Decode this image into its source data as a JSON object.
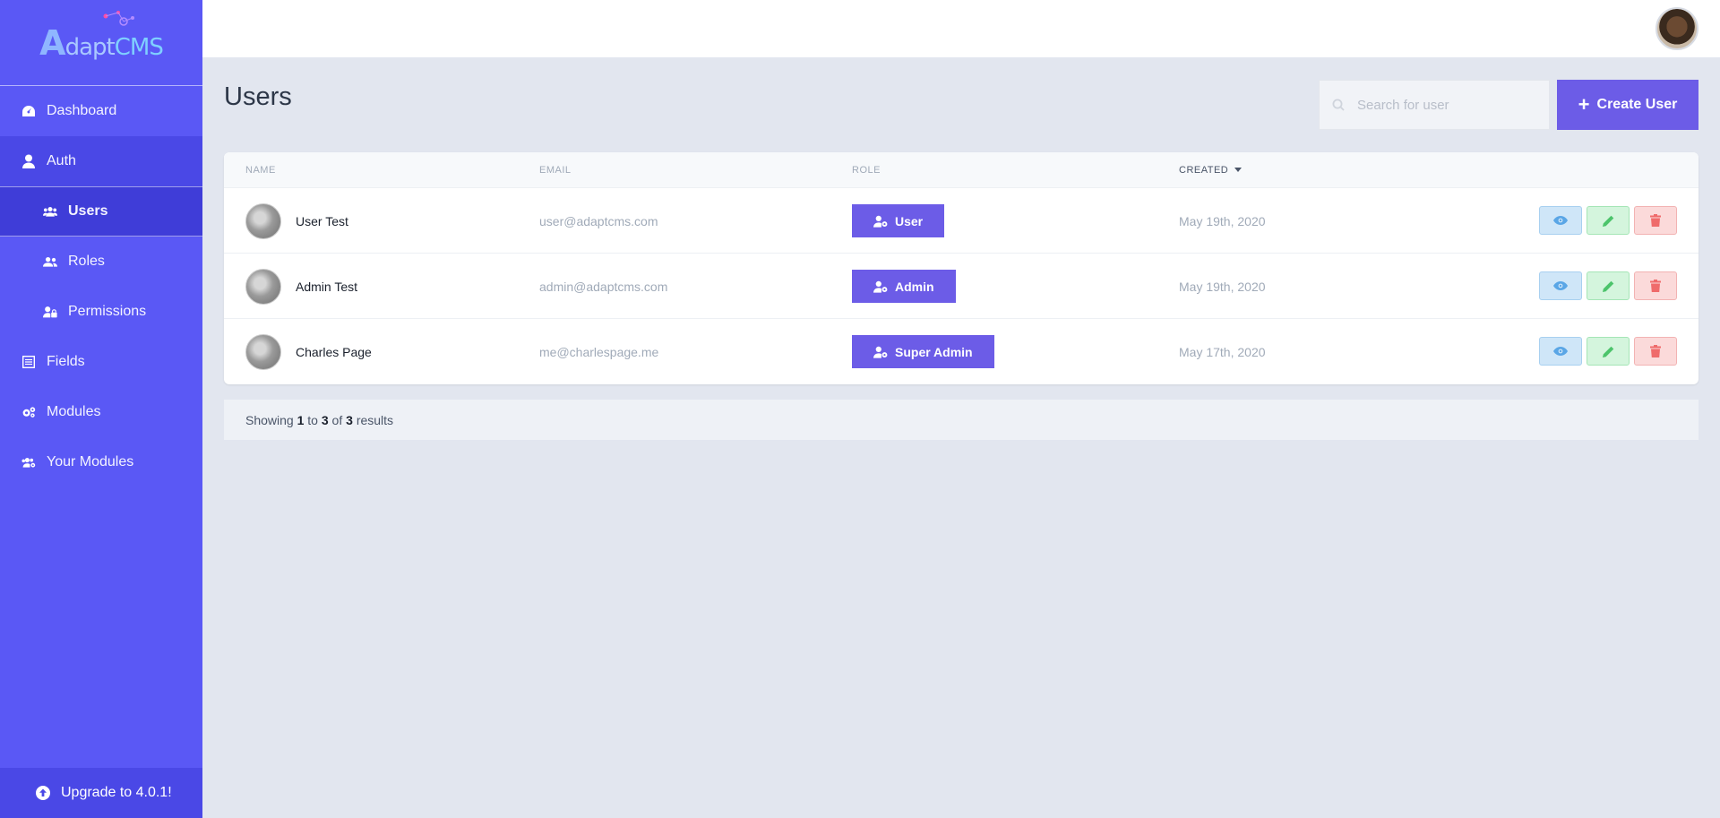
{
  "brand": {
    "logo_letter": "A",
    "logo_rest": "dapt",
    "logo_cms": "CMS"
  },
  "sidebar": {
    "items": [
      {
        "label": "Dashboard",
        "icon": "tachometer-icon"
      },
      {
        "label": "Auth",
        "icon": "user-icon"
      },
      {
        "label": "Users",
        "icon": "users-icon"
      },
      {
        "label": "Roles",
        "icon": "user-friends-icon"
      },
      {
        "label": "Permissions",
        "icon": "user-lock-icon"
      },
      {
        "label": "Fields",
        "icon": "list-icon"
      },
      {
        "label": "Modules",
        "icon": "cogs-icon"
      },
      {
        "label": "Your Modules",
        "icon": "users-cog-icon"
      }
    ],
    "upgrade_label": "Upgrade to 4.0.1!"
  },
  "page": {
    "title": "Users"
  },
  "search": {
    "placeholder": "Search for user"
  },
  "create_button": {
    "label": "Create User"
  },
  "table": {
    "headers": {
      "name": "NAME",
      "email": "EMAIL",
      "role": "ROLE",
      "created": "CREATED"
    },
    "sort": {
      "column": "created",
      "direction": "desc"
    },
    "rows": [
      {
        "name": "User Test",
        "email": "user@adaptcms.com",
        "role": "User",
        "created": "May 19th, 2020"
      },
      {
        "name": "Admin Test",
        "email": "admin@adaptcms.com",
        "role": "Admin",
        "created": "May 19th, 2020"
      },
      {
        "name": "Charles Page",
        "email": "me@charlespage.me",
        "role": "Super Admin",
        "created": "May 17th, 2020"
      }
    ]
  },
  "pagination": {
    "prefix": "Showing",
    "from": "1",
    "to_word": "to",
    "to": "3",
    "of_word": "of",
    "total": "3",
    "suffix": "results"
  },
  "colors": {
    "sidebar": "#5a58f5",
    "accent": "#6c5ce7",
    "background": "#e2e6ef"
  }
}
